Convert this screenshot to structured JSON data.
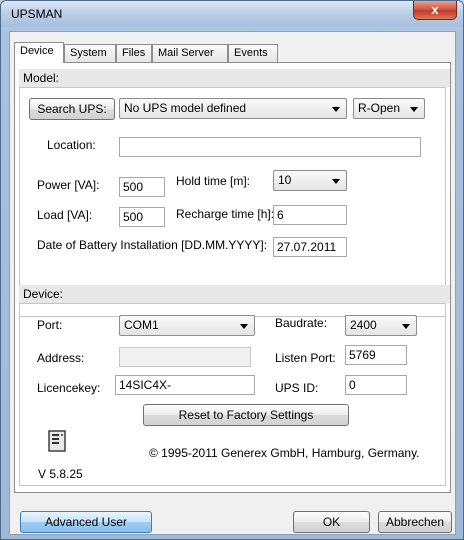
{
  "window": {
    "title": "UPSMAN",
    "close_glyph": "x"
  },
  "tabs": [
    {
      "label": "Device",
      "active": true
    },
    {
      "label": "System",
      "active": false
    },
    {
      "label": "Files",
      "active": false
    },
    {
      "label": "Mail Server",
      "active": false
    },
    {
      "label": "Events",
      "active": false
    }
  ],
  "model": {
    "section_title": "Model:",
    "search_button": "Search UPS:",
    "model_value": "No UPS model defined",
    "mode_value": "R-Open",
    "location_label": "Location:",
    "location_value": "",
    "power_label": "Power [VA]:",
    "power_value": "500",
    "hold_time_label": "Hold time [m]:",
    "hold_time_value": "10",
    "load_label": "Load [VA]:",
    "load_value": "500",
    "recharge_label": "Recharge time [h]:",
    "recharge_value": "6",
    "battery_label": "Date of Battery Installation [DD.MM.YYYY]:",
    "battery_value": "27.07.2011"
  },
  "device": {
    "section_title": "Device:",
    "port_label": "Port:",
    "port_value": "COM1",
    "baudrate_label": "Baudrate:",
    "baudrate_value": "2400",
    "address_label": "Address:",
    "address_value": "",
    "listen_port_label": "Listen Port:",
    "listen_port_value": "5769",
    "licence_label": "Licencekey:",
    "licence_value": "14SIC4X-",
    "ups_id_label": "UPS ID:",
    "ups_id_value": "0",
    "reset_button": "Reset to Factory Settings"
  },
  "footer": {
    "copyright": "© 1995-2011 Generex GmbH, Hamburg, Germany.",
    "version": "V 5.8.25",
    "icon": "ups-device-icon"
  },
  "buttons": {
    "advanced": "Advanced User",
    "ok": "OK",
    "cancel": "Abbrechen"
  }
}
